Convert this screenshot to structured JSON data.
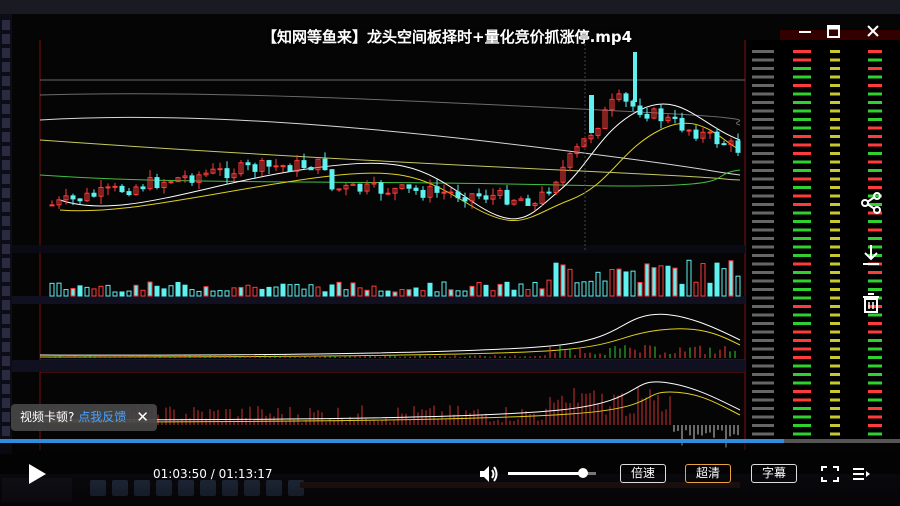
{
  "video": {
    "title": "【知网等鱼来】龙头空间板择时+量化竞价抓涨停.mp4",
    "current_time": "01:03:50",
    "separator": "/",
    "total_time": "01:13:17",
    "progress": 0.871,
    "volume": 0.85
  },
  "notice": {
    "text": "视频卡顿?",
    "link": "点我反馈"
  },
  "controls": {
    "speed_label": "倍速",
    "quality_label": "超清",
    "subtitle_label": "字幕"
  },
  "icons": {
    "minimize": "minimize-icon",
    "restore": "restore-icon",
    "close": "close-icon",
    "share": "share-icon",
    "download": "download-icon",
    "delete": "trash-icon",
    "play": "play-icon",
    "volume": "volume-icon",
    "fullscreen": "fullscreen-icon",
    "playlist": "playlist-icon"
  },
  "colors": {
    "accent": "#2f8de0",
    "quality_border": "#e8a33c",
    "up_candle": "#ff3b3b",
    "down_candle": "#5ff0f0"
  }
}
